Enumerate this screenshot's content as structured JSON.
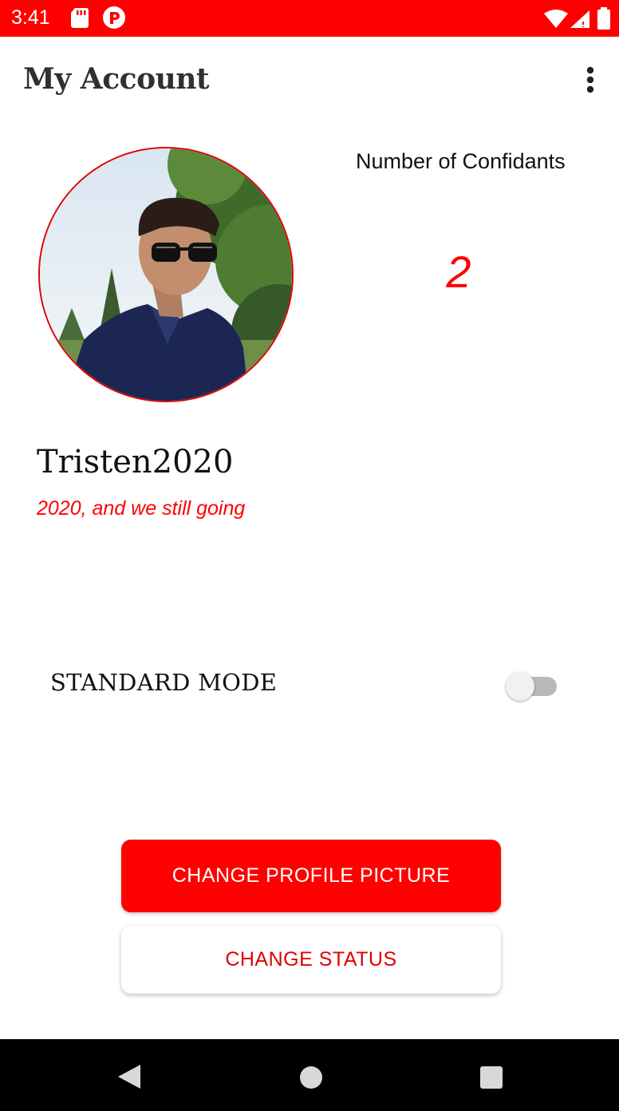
{
  "status_bar": {
    "time": "3:41",
    "icons": [
      "sd-card-icon",
      "app-notification-icon",
      "wifi-icon",
      "cell-signal-icon",
      "battery-icon"
    ]
  },
  "app_bar": {
    "title": "My Account",
    "menu_icon": "more-vert-icon"
  },
  "profile": {
    "username": "Tristen2020",
    "status": "2020, and we still going"
  },
  "confidants": {
    "label": "Number of Confidants",
    "count": "2"
  },
  "mode": {
    "label": "STANDARD MODE",
    "enabled": false
  },
  "buttons": {
    "change_picture": "CHANGE PROFILE PICTURE",
    "change_status": "CHANGE STATUS"
  },
  "nav_bar": {
    "icons": [
      "back-icon",
      "home-icon",
      "recents-icon"
    ]
  },
  "colors": {
    "accent": "#ff0000",
    "status_bar": "#ff0000",
    "nav_bar": "#000000"
  }
}
